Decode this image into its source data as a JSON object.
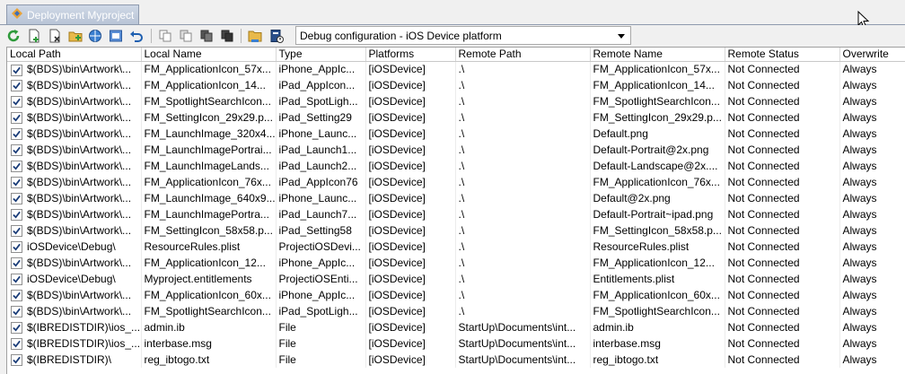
{
  "tab": {
    "title": "Deployment Myproject"
  },
  "toolbar": {
    "buttons": [
      "refresh-icon",
      "add-file-icon",
      "remove-file-icon",
      "add-folder-icon",
      "connect-icon",
      "deploy-icon",
      "revert-icon",
      "copy-icon",
      "paste-icon",
      "cut-icon",
      "delete-icon",
      "open-folder-icon",
      "properties-icon"
    ],
    "configuration": "Debug configuration - iOS Device platform"
  },
  "columns": [
    "Local Path",
    "Local Name",
    "Type",
    "Platforms",
    "Remote Path",
    "Remote Name",
    "Remote Status",
    "Overwrite"
  ],
  "rows": [
    {
      "local_path": "$(BDS)\\bin\\Artwork\\...",
      "local_name": "FM_ApplicationIcon_57x...",
      "type": "iPhone_AppIc...",
      "platforms": "[iOSDevice]",
      "remote_path": ".\\",
      "remote_name": "FM_ApplicationIcon_57x...",
      "status": "Not Connected",
      "overwrite": "Always"
    },
    {
      "local_path": "$(BDS)\\bin\\Artwork\\...",
      "local_name": "FM_ApplicationIcon_14...",
      "type": "iPad_AppIcon...",
      "platforms": "[iOSDevice]",
      "remote_path": ".\\",
      "remote_name": "FM_ApplicationIcon_14...",
      "status": "Not Connected",
      "overwrite": "Always"
    },
    {
      "local_path": "$(BDS)\\bin\\Artwork\\...",
      "local_name": "FM_SpotlightSearchIcon...",
      "type": "iPad_SpotLigh...",
      "platforms": "[iOSDevice]",
      "remote_path": ".\\",
      "remote_name": "FM_SpotlightSearchIcon...",
      "status": "Not Connected",
      "overwrite": "Always"
    },
    {
      "local_path": "$(BDS)\\bin\\Artwork\\...",
      "local_name": "FM_SettingIcon_29x29.p...",
      "type": "iPad_Setting29",
      "platforms": "[iOSDevice]",
      "remote_path": ".\\",
      "remote_name": "FM_SettingIcon_29x29.p...",
      "status": "Not Connected",
      "overwrite": "Always"
    },
    {
      "local_path": "$(BDS)\\bin\\Artwork\\...",
      "local_name": "FM_LaunchImage_320x4...",
      "type": "iPhone_Launc...",
      "platforms": "[iOSDevice]",
      "remote_path": ".\\",
      "remote_name": "Default.png",
      "status": "Not Connected",
      "overwrite": "Always"
    },
    {
      "local_path": "$(BDS)\\bin\\Artwork\\...",
      "local_name": "FM_LaunchImagePortrai...",
      "type": "iPad_Launch1...",
      "platforms": "[iOSDevice]",
      "remote_path": ".\\",
      "remote_name": "Default-Portrait@2x.png",
      "status": "Not Connected",
      "overwrite": "Always"
    },
    {
      "local_path": "$(BDS)\\bin\\Artwork\\...",
      "local_name": "FM_LaunchImageLands...",
      "type": "iPad_Launch2...",
      "platforms": "[iOSDevice]",
      "remote_path": ".\\",
      "remote_name": "Default-Landscape@2x....",
      "status": "Not Connected",
      "overwrite": "Always"
    },
    {
      "local_path": "$(BDS)\\bin\\Artwork\\...",
      "local_name": "FM_ApplicationIcon_76x...",
      "type": "iPad_AppIcon76",
      "platforms": "[iOSDevice]",
      "remote_path": ".\\",
      "remote_name": "FM_ApplicationIcon_76x...",
      "status": "Not Connected",
      "overwrite": "Always"
    },
    {
      "local_path": "$(BDS)\\bin\\Artwork\\...",
      "local_name": "FM_LaunchImage_640x9...",
      "type": "iPhone_Launc...",
      "platforms": "[iOSDevice]",
      "remote_path": ".\\",
      "remote_name": "Default@2x.png",
      "status": "Not Connected",
      "overwrite": "Always"
    },
    {
      "local_path": "$(BDS)\\bin\\Artwork\\...",
      "local_name": "FM_LaunchImagePortra...",
      "type": "iPad_Launch7...",
      "platforms": "[iOSDevice]",
      "remote_path": ".\\",
      "remote_name": "Default-Portrait~ipad.png",
      "status": "Not Connected",
      "overwrite": "Always"
    },
    {
      "local_path": "$(BDS)\\bin\\Artwork\\...",
      "local_name": "FM_SettingIcon_58x58.p...",
      "type": "iPad_Setting58",
      "platforms": "[iOSDevice]",
      "remote_path": ".\\",
      "remote_name": "FM_SettingIcon_58x58.p...",
      "status": "Not Connected",
      "overwrite": "Always"
    },
    {
      "local_path": "iOSDevice\\Debug\\",
      "local_name": "ResourceRules.plist",
      "type": "ProjectiOSDevi...",
      "platforms": "[iOSDevice]",
      "remote_path": ".\\",
      "remote_name": "ResourceRules.plist",
      "status": "Not Connected",
      "overwrite": "Always"
    },
    {
      "local_path": "$(BDS)\\bin\\Artwork\\...",
      "local_name": "FM_ApplicationIcon_12...",
      "type": "iPhone_AppIc...",
      "platforms": "[iOSDevice]",
      "remote_path": ".\\",
      "remote_name": "FM_ApplicationIcon_12...",
      "status": "Not Connected",
      "overwrite": "Always"
    },
    {
      "local_path": "iOSDevice\\Debug\\",
      "local_name": "Myproject.entitlements",
      "type": "ProjectiOSEnti...",
      "platforms": "[iOSDevice]",
      "remote_path": ".\\",
      "remote_name": "Entitlements.plist",
      "status": "Not Connected",
      "overwrite": "Always"
    },
    {
      "local_path": "$(BDS)\\bin\\Artwork\\...",
      "local_name": "FM_ApplicationIcon_60x...",
      "type": "iPhone_AppIc...",
      "platforms": "[iOSDevice]",
      "remote_path": ".\\",
      "remote_name": "FM_ApplicationIcon_60x...",
      "status": "Not Connected",
      "overwrite": "Always"
    },
    {
      "local_path": "$(BDS)\\bin\\Artwork\\...",
      "local_name": "FM_SpotlightSearchIcon...",
      "type": "iPad_SpotLigh...",
      "platforms": "[iOSDevice]",
      "remote_path": ".\\",
      "remote_name": "FM_SpotlightSearchIcon...",
      "status": "Not Connected",
      "overwrite": "Always"
    },
    {
      "local_path": "$(IBREDISTDIR)\\ios_...",
      "local_name": "admin.ib",
      "type": "File",
      "platforms": "[iOSDevice]",
      "remote_path": "StartUp\\Documents\\int...",
      "remote_name": "admin.ib",
      "status": "Not Connected",
      "overwrite": "Always"
    },
    {
      "local_path": "$(IBREDISTDIR)\\ios_...",
      "local_name": "interbase.msg",
      "type": "File",
      "platforms": "[iOSDevice]",
      "remote_path": "StartUp\\Documents\\int...",
      "remote_name": "interbase.msg",
      "status": "Not Connected",
      "overwrite": "Always"
    },
    {
      "local_path": "$(IBREDISTDIR)\\",
      "local_name": "reg_ibtogo.txt",
      "type": "File",
      "platforms": "[iOSDevice]",
      "remote_path": "StartUp\\Documents\\int...",
      "remote_name": "reg_ibtogo.txt",
      "status": "Not Connected",
      "overwrite": "Always"
    }
  ]
}
